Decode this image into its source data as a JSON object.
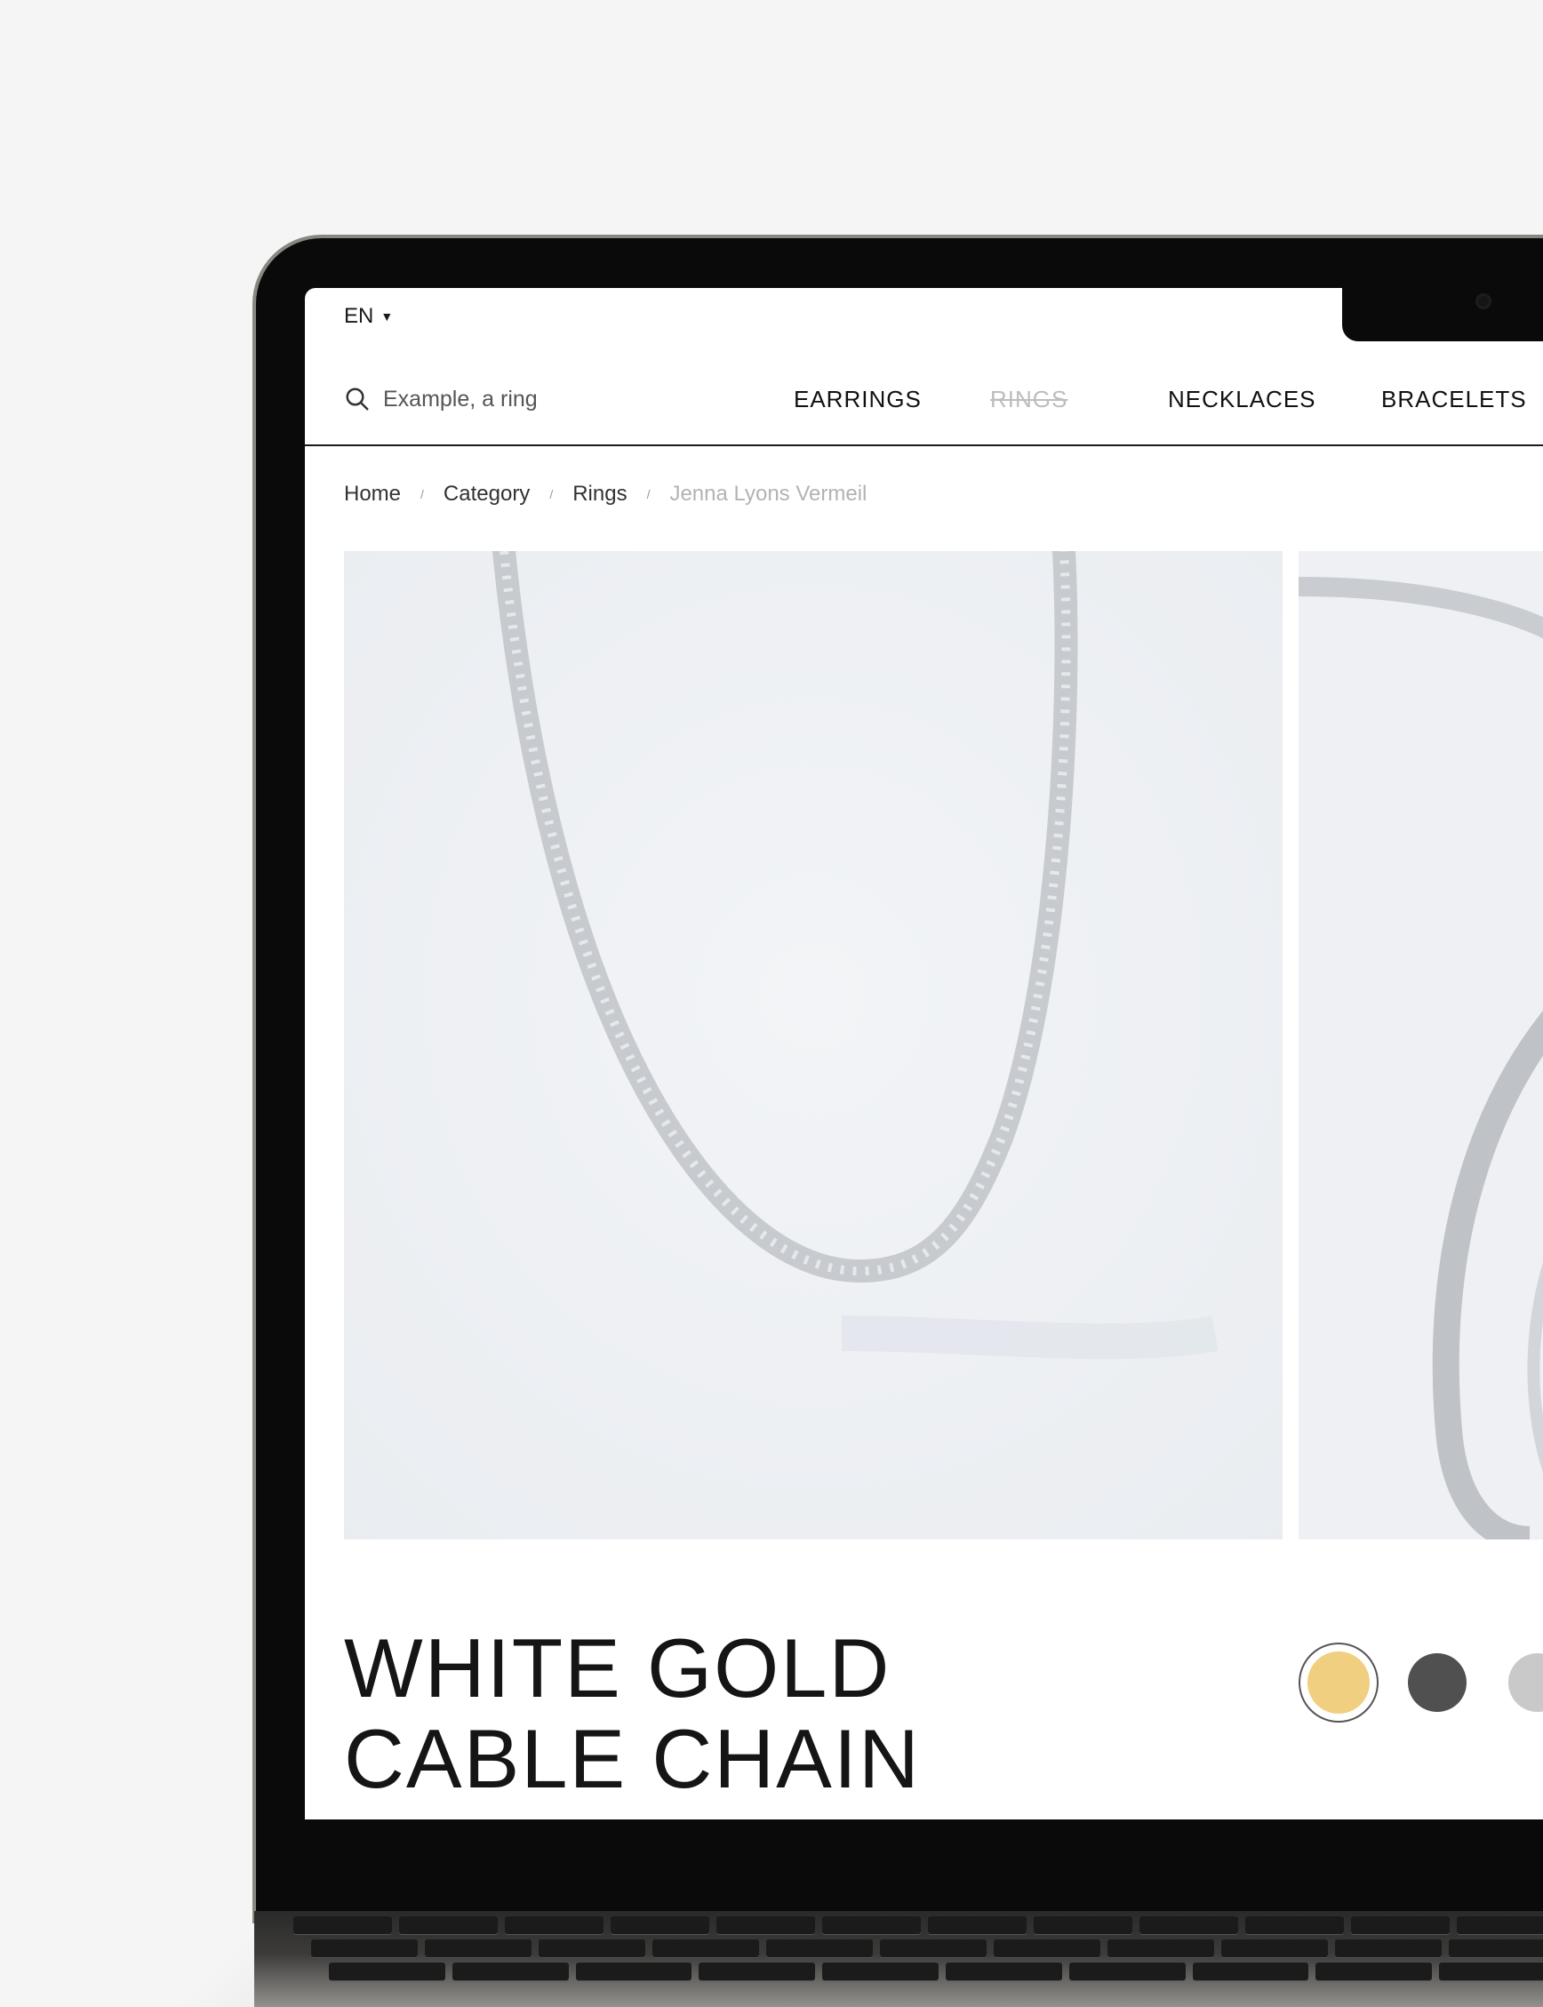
{
  "language": {
    "label": "EN"
  },
  "search": {
    "placeholder": "Example, a ring"
  },
  "nav": [
    {
      "label": "EARRINGS",
      "disabled": false
    },
    {
      "label": "RINGS",
      "disabled": true
    },
    {
      "label": "NECKLACES",
      "disabled": false
    },
    {
      "label": "BRACELETS",
      "disabled": false
    }
  ],
  "breadcrumb": [
    "Home",
    "Category",
    "Rings",
    "Jenna Lyons Vermeil"
  ],
  "product": {
    "title_line1": "WHITE GOLD",
    "title_line2": "CABLE CHAIN",
    "swatches": [
      {
        "color": "#f0cf80",
        "selected": true
      },
      {
        "color": "#505050",
        "selected": false
      },
      {
        "color": "#c9c9c9",
        "selected": false
      }
    ]
  },
  "colors": {
    "background": "#f4f5f4",
    "text": "#151515",
    "muted": "#b3b3b3",
    "photo_bg": "#eef0f3"
  }
}
